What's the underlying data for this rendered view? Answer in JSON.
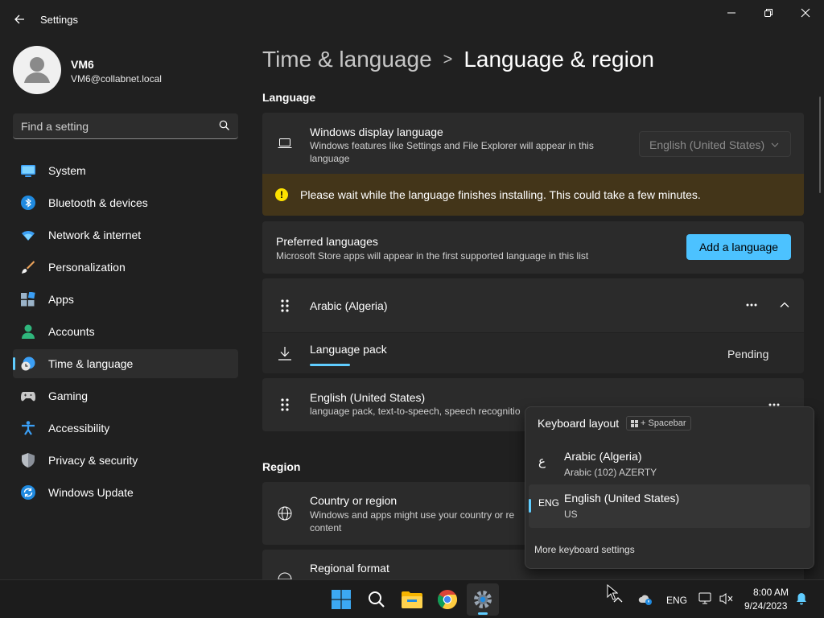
{
  "window": {
    "title": "Settings",
    "controls": {
      "minimize": "minimize-icon",
      "maximize": "restore-icon",
      "close": "close-icon"
    }
  },
  "user": {
    "name": "VM6",
    "email": "VM6@collabnet.local"
  },
  "search": {
    "placeholder": "Find a setting"
  },
  "nav": {
    "items": [
      {
        "label": "System",
        "icon": "system-icon"
      },
      {
        "label": "Bluetooth & devices",
        "icon": "bluetooth-icon"
      },
      {
        "label": "Network & internet",
        "icon": "wifi-icon"
      },
      {
        "label": "Personalization",
        "icon": "brush-icon"
      },
      {
        "label": "Apps",
        "icon": "apps-icon"
      },
      {
        "label": "Accounts",
        "icon": "accounts-icon"
      },
      {
        "label": "Time & language",
        "icon": "time-language-icon",
        "active": true
      },
      {
        "label": "Gaming",
        "icon": "gaming-icon"
      },
      {
        "label": "Accessibility",
        "icon": "accessibility-icon"
      },
      {
        "label": "Privacy & security",
        "icon": "shield-icon"
      },
      {
        "label": "Windows Update",
        "icon": "update-icon"
      }
    ]
  },
  "breadcrumb": {
    "parent": "Time & language",
    "separator": ">",
    "current": "Language & region"
  },
  "language": {
    "section_title": "Language",
    "display": {
      "title": "Windows display language",
      "desc": "Windows features like Settings and File Explorer will appear in this language",
      "value": "English (United States)"
    },
    "warning": {
      "icon": "warning-icon",
      "text": "Please wait while the language finishes installing. This could take a few minutes."
    },
    "preferred": {
      "title": "Preferred languages",
      "desc": "Microsoft Store apps will appear in the first supported language in this list",
      "add_button": "Add a language"
    },
    "arabic": {
      "name": "Arabic (Algeria)",
      "language_pack": "Language pack",
      "status": "Pending",
      "progress": 0.15
    },
    "english": {
      "name": "English (United States)",
      "desc": "language pack, text-to-speech, speech recognitio"
    }
  },
  "region": {
    "section_title": "Region",
    "country": {
      "title": "Country or region",
      "desc": "Windows and apps might use your country or re",
      "desc2": "content"
    },
    "format": {
      "title": "Regional format"
    }
  },
  "flyout": {
    "title": "Keyboard layout",
    "hint": "+ Spacebar",
    "items": [
      {
        "code": "ع",
        "name": "Arabic (Algeria)",
        "sub": "Arabic (102) AZERTY"
      },
      {
        "code": "ENG",
        "name": "English (United States)",
        "sub": "US",
        "selected": true
      }
    ],
    "link": "More keyboard settings"
  },
  "taskbar": {
    "apps": [
      "start-icon",
      "search-icon",
      "file-explorer-icon",
      "chrome-icon",
      "settings-icon"
    ],
    "lang": "ENG",
    "time": "8:00 AM",
    "date": "9/24/2023"
  },
  "colors": {
    "accent": "#60cdff",
    "button_accent": "#4cc2ff",
    "warning_bg": "#433519",
    "warning_icon": "#fce100"
  }
}
